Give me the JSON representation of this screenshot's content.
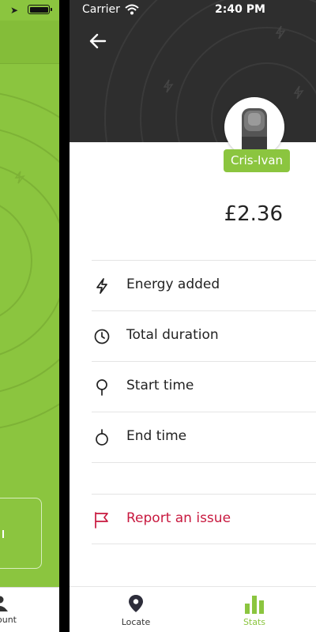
{
  "status_bar": {
    "carrier": "Carrier",
    "time": "2:40 PM"
  },
  "left_panel": {
    "nav_label": "ount"
  },
  "profile": {
    "name": "Cris-Ivan"
  },
  "session": {
    "price": "£2.36"
  },
  "details": {
    "energy_label": "Energy added",
    "duration_label": "Total duration",
    "start_label": "Start time",
    "end_label": "End time"
  },
  "actions": {
    "report_label": "Report an issue"
  },
  "bottom_nav": {
    "locate_label": "Locate",
    "stats_label": "Stats"
  },
  "colors": {
    "brand_green": "#8bc53f",
    "header_dark": "#2e2e2e",
    "danger_red": "#c8193f"
  },
  "icons": [
    "back-arrow-icon",
    "wifi-icon",
    "lightning-icon",
    "clock-icon",
    "pin-icon",
    "stopwatch-icon",
    "flag-icon",
    "location-pin-icon",
    "bar-chart-icon",
    "user-icon"
  ]
}
